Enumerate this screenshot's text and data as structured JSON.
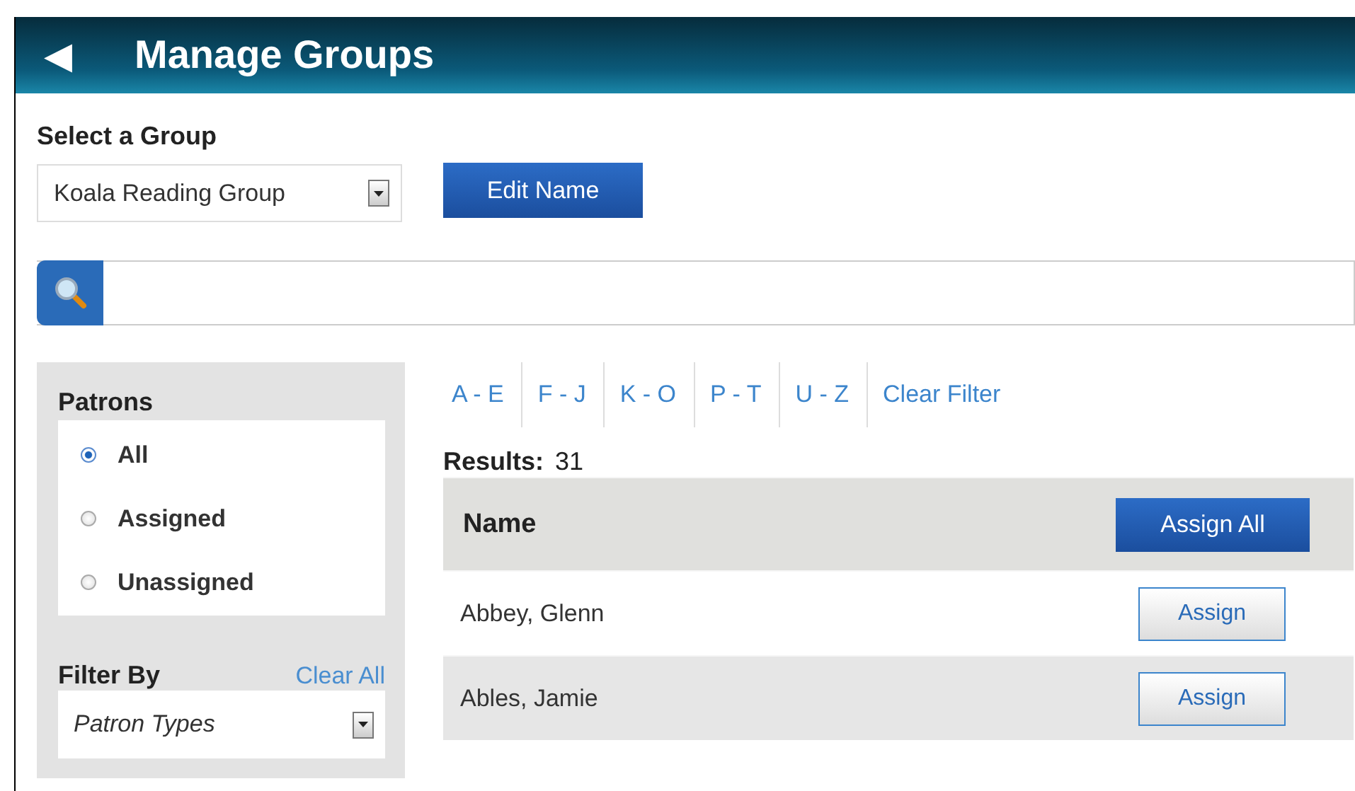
{
  "header": {
    "back_icon": "◀",
    "title": "Manage Groups"
  },
  "group_select": {
    "label": "Select a Group",
    "value": "Koala Reading Group",
    "edit_button": "Edit Name"
  },
  "patrons": {
    "title": "Patrons",
    "options": [
      {
        "label": "All",
        "selected": true
      },
      {
        "label": "Assigned",
        "selected": false
      },
      {
        "label": "Unassigned",
        "selected": false
      }
    ]
  },
  "filter": {
    "title": "Filter By",
    "clear": "Clear All",
    "select_value": "Patron Types"
  },
  "letter_filters": [
    "A - E",
    "F - J",
    "K - O",
    "P - T",
    "U - Z",
    "Clear Filter"
  ],
  "results": {
    "label": "Results:",
    "count": "31"
  },
  "table": {
    "column": "Name",
    "assign_all": "Assign All",
    "rows": [
      {
        "name": "Abbey, Glenn",
        "action": "Assign"
      },
      {
        "name": "Ables, Jamie",
        "action": "Assign"
      }
    ]
  }
}
